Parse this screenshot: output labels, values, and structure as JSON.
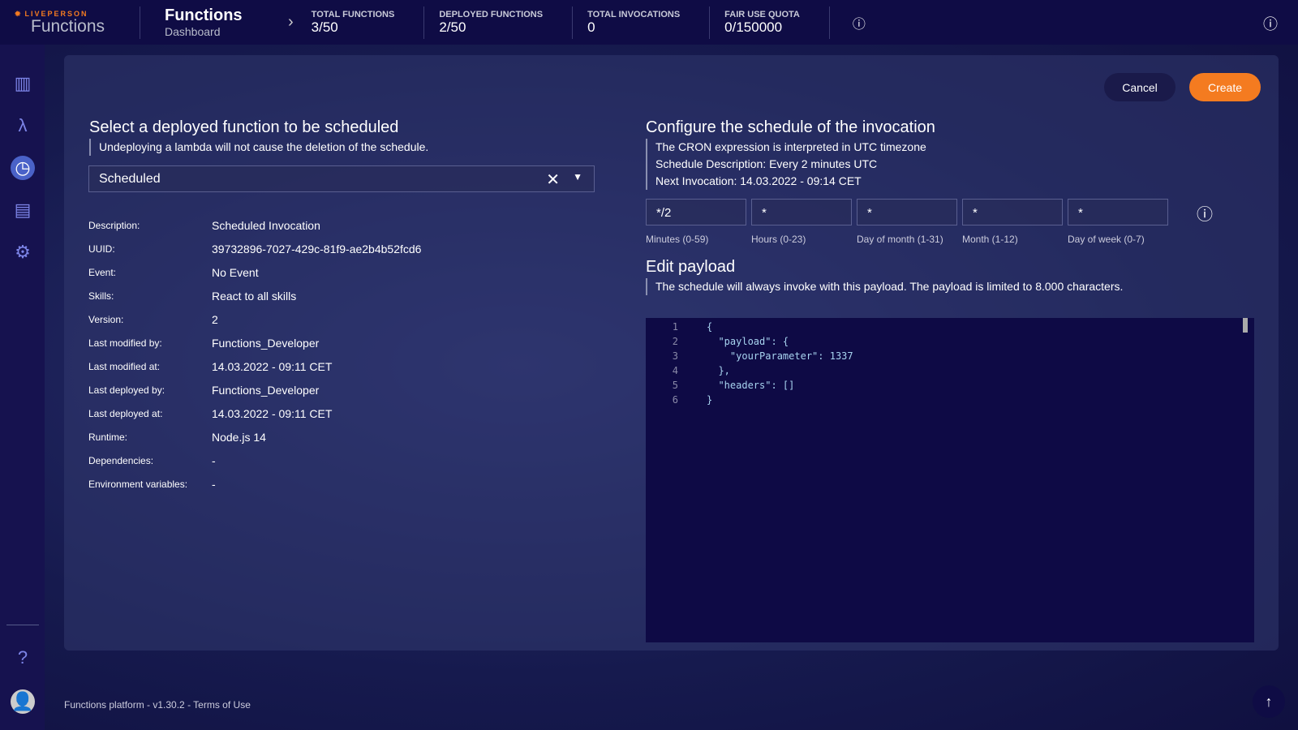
{
  "header": {
    "brand": "LIVEPERSON",
    "product": "Functions",
    "title": "Functions",
    "subtitle": "Dashboard",
    "stats": [
      {
        "label": "TOTAL FUNCTIONS",
        "value": "3/50"
      },
      {
        "label": "DEPLOYED FUNCTIONS",
        "value": "2/50"
      },
      {
        "label": "TOTAL INVOCATIONS",
        "value": "0"
      },
      {
        "label": "FAIR USE QUOTA",
        "value": "0/150000"
      }
    ]
  },
  "sidebar": {
    "items": [
      "analytics-icon",
      "lambda-icon",
      "schedule-clock-icon",
      "logs-document-icon",
      "settings-gear-icon"
    ],
    "active": "schedule-clock-icon"
  },
  "actions": {
    "cancel": "Cancel",
    "create": "Create",
    "accent": "#f47b20"
  },
  "left": {
    "heading": "Select a deployed function to be scheduled",
    "note": "Undeploying a lambda will not cause the deletion of the schedule.",
    "selected": "Scheduled",
    "details": [
      [
        "Description:",
        "Scheduled Invocation"
      ],
      [
        "UUID:",
        "39732896-7027-429c-81f9-ae2b4b52fcd6"
      ],
      [
        "Event:",
        "No Event"
      ],
      [
        "Skills:",
        "React to all skills"
      ],
      [
        "Version:",
        "2"
      ],
      [
        "Last modified by:",
        "Functions_Developer"
      ],
      [
        "Last modified at:",
        "14.03.2022 - 09:11 CET"
      ],
      [
        "Last deployed by:",
        "Functions_Developer"
      ],
      [
        "Last deployed at:",
        "14.03.2022 - 09:11 CET"
      ],
      [
        "Runtime:",
        "Node.js 14"
      ],
      [
        "Dependencies:",
        "-"
      ],
      [
        "Environment variables:",
        "-"
      ]
    ]
  },
  "right": {
    "heading": "Configure the schedule of the invocation",
    "notes": [
      "The CRON expression is interpreted in UTC timezone",
      "Schedule Description: Every 2 minutes UTC",
      "Next Invocation: 14.03.2022 - 09:14 CET"
    ],
    "cron": [
      {
        "value": "*/2",
        "label": "Minutes (0-59)"
      },
      {
        "value": "*",
        "label": "Hours (0-23)"
      },
      {
        "value": "*",
        "label": "Day of month (1-31)"
      },
      {
        "value": "*",
        "label": "Month (1-12)"
      },
      {
        "value": "*",
        "label": "Day of week (0-7)"
      }
    ],
    "payload_heading": "Edit payload",
    "payload_note": "The schedule will always invoke with this payload. The payload is limited to 8.000 characters.",
    "code": [
      "{",
      "  \"payload\": {",
      "    \"yourParameter\": 1337",
      "  },",
      "  \"headers\": []",
      "}"
    ]
  },
  "footer": {
    "text": "Functions platform - v1.30.2 - Terms of Use"
  }
}
